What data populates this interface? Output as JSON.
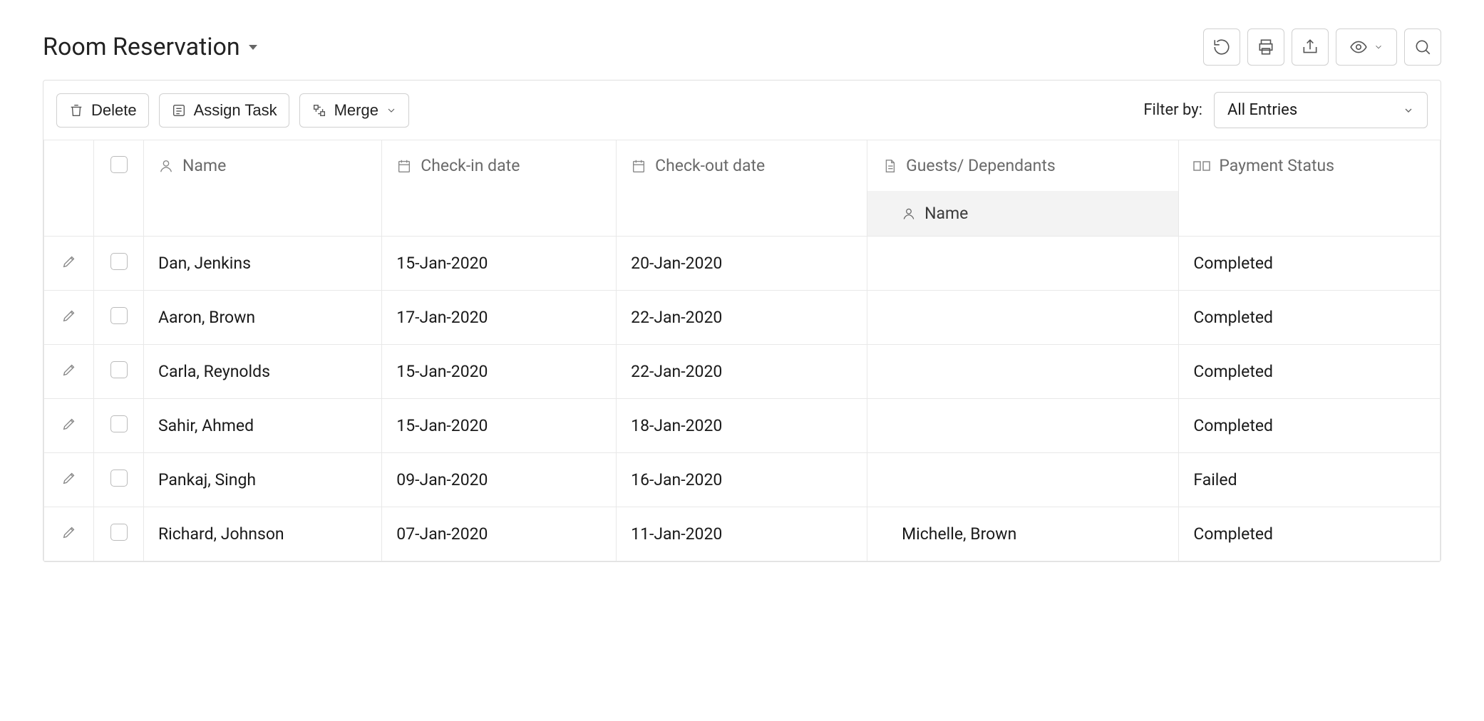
{
  "page": {
    "title": "Room Reservation"
  },
  "toolbar": {
    "delete_label": "Delete",
    "assign_task_label": "Assign Task",
    "merge_label": "Merge"
  },
  "filter": {
    "label": "Filter by:",
    "selected": "All Entries"
  },
  "columns": {
    "name": "Name",
    "checkin": "Check-in date",
    "checkout": "Check-out date",
    "guests": "Guests/ Dependants",
    "guests_sub": "Name",
    "payment": "Payment Status"
  },
  "rows": [
    {
      "name": "Dan, Jenkins",
      "checkin": "15-Jan-2020",
      "checkout": "20-Jan-2020",
      "guest": "",
      "payment": "Completed"
    },
    {
      "name": "Aaron, Brown",
      "checkin": "17-Jan-2020",
      "checkout": "22-Jan-2020",
      "guest": "",
      "payment": "Completed"
    },
    {
      "name": "Carla, Reynolds",
      "checkin": "15-Jan-2020",
      "checkout": "22-Jan-2020",
      "guest": "",
      "payment": "Completed"
    },
    {
      "name": "Sahir, Ahmed",
      "checkin": "15-Jan-2020",
      "checkout": "18-Jan-2020",
      "guest": "",
      "payment": "Completed"
    },
    {
      "name": "Pankaj, Singh",
      "checkin": "09-Jan-2020",
      "checkout": "16-Jan-2020",
      "guest": "",
      "payment": "Failed"
    },
    {
      "name": "Richard, Johnson",
      "checkin": "07-Jan-2020",
      "checkout": "11-Jan-2020",
      "guest": "Michelle, Brown",
      "payment": "Completed"
    }
  ]
}
